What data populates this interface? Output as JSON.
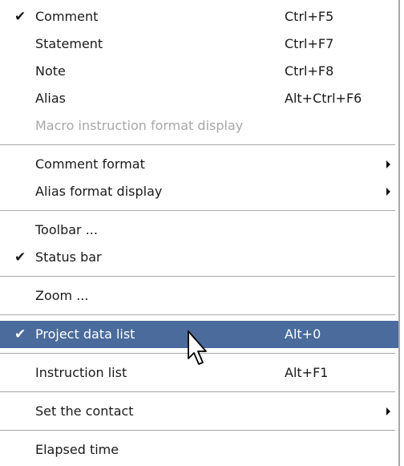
{
  "menu": {
    "items": [
      {
        "label": "Comment",
        "shortcut": "Ctrl+F5",
        "checked": "✔"
      },
      {
        "label": "Statement",
        "shortcut": "Ctrl+F7",
        "checked": ""
      },
      {
        "label": "Note",
        "shortcut": "Ctrl+F8",
        "checked": ""
      },
      {
        "label": "Alias",
        "shortcut": "Alt+Ctrl+F6",
        "checked": ""
      },
      {
        "label": "Macro instruction format display",
        "shortcut": "",
        "checked": ""
      },
      {
        "label": "Comment format",
        "shortcut": "",
        "checked": ""
      },
      {
        "label": "Alias format display",
        "shortcut": "",
        "checked": ""
      },
      {
        "label": "Toolbar ...",
        "shortcut": "",
        "checked": ""
      },
      {
        "label": "Status bar",
        "shortcut": "",
        "checked": "✔"
      },
      {
        "label": "Zoom ...",
        "shortcut": "",
        "checked": ""
      },
      {
        "label": "Project data list",
        "shortcut": "Alt+0",
        "checked": "✔"
      },
      {
        "label": "Instruction list",
        "shortcut": "Alt+F1",
        "checked": ""
      },
      {
        "label": "Set the contact",
        "shortcut": "",
        "checked": ""
      },
      {
        "label": "Elapsed time",
        "shortcut": "",
        "checked": ""
      }
    ]
  },
  "colors": {
    "highlight": "#4a6b9c",
    "disabled_text": "#a8a8a8",
    "border": "#a7a6aa"
  },
  "icons": {
    "check": "check-icon",
    "submenu": "submenu-arrow-icon",
    "cursor": "mouse-pointer-icon"
  }
}
